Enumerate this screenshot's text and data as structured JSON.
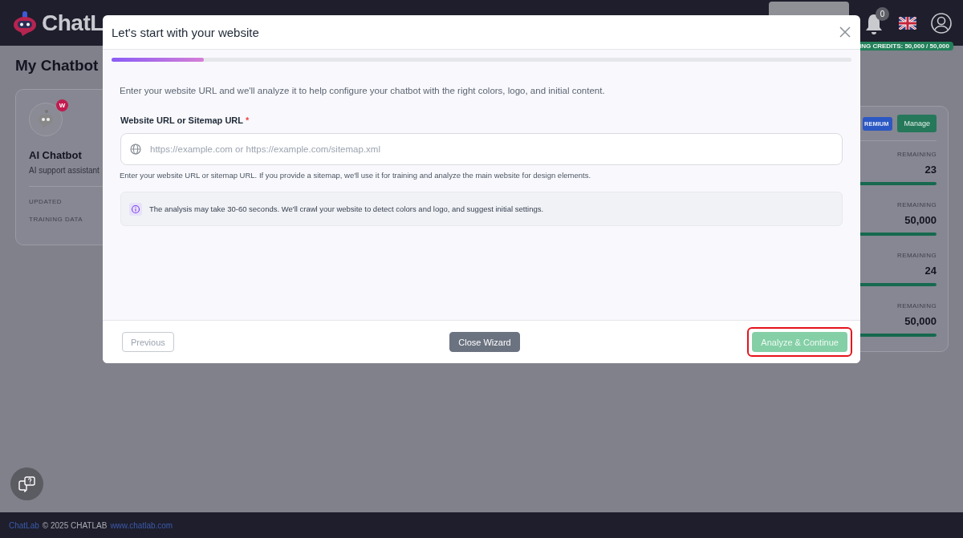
{
  "header": {
    "logo_text": "ChatL",
    "notification_count": "0",
    "credits_badge": "ING CREDITS: 50,000 / 50,000"
  },
  "page": {
    "title": "My Chatbot",
    "chatbot_card": {
      "avatar_badge": "W",
      "name": "AI Chatbot",
      "description": "AI support assistant",
      "meta_labels": [
        "UPDATED",
        "TRAINING DATA"
      ]
    },
    "plan_card": {
      "plan_badge": "REMIUM",
      "manage_button": "Manage",
      "usage": [
        {
          "label": "REMAINING",
          "value": "23",
          "level": 1
        },
        {
          "label": "REMAINING",
          "value": "50,000",
          "level": 1
        },
        {
          "label": "REMAINING",
          "value": "24",
          "level": 1
        },
        {
          "label": "REMAINING",
          "value": "50,000",
          "level": 1
        }
      ]
    }
  },
  "footer": {
    "brand_link": "ChatLab",
    "copyright": "© 2025 CHATLAB",
    "site_link": "www.chatlab.com"
  },
  "modal": {
    "title": "Let's start with your website",
    "progress": {
      "level": 0.125
    },
    "intro": "Enter your website URL and we'll analyze it to help configure your chatbot with the right colors, logo, and initial content.",
    "field": {
      "label": "Website URL or Sitemap URL",
      "required_mark": "*",
      "placeholder": "https://example.com or https://example.com/sitemap.xml",
      "hint": "Enter your website URL or sitemap URL. If you provide a sitemap, we'll use it for training and analyze the main website for design elements."
    },
    "notice": "The analysis may take 30-60 seconds. We'll crawl your website to detect colors and logo, and suggest initial settings.",
    "buttons": [
      {
        "kind": "secondary",
        "label": "Previous",
        "disabled": true,
        "highlighted": false
      },
      {
        "kind": "neutral",
        "label": "Close Wizard",
        "disabled": false,
        "highlighted": false
      },
      {
        "kind": "primary",
        "label": "Analyze & Continue",
        "disabled": true,
        "highlighted": true
      }
    ]
  }
}
